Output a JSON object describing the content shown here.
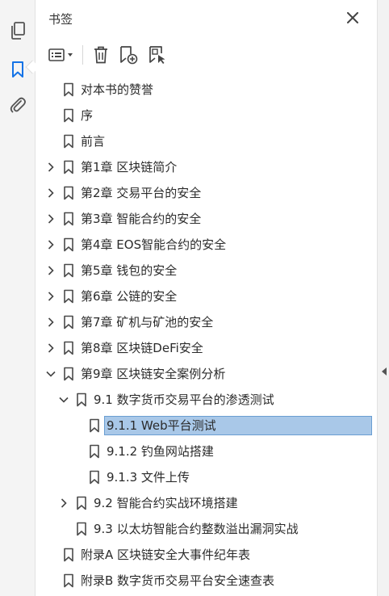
{
  "panel": {
    "title": "书签",
    "close_icon": "close-icon"
  },
  "rail": {
    "items": [
      {
        "name": "pages-icon"
      },
      {
        "name": "bookmark-icon",
        "active": true
      },
      {
        "name": "attachment-icon"
      }
    ]
  },
  "toolbar": {
    "buttons": [
      "options-menu-icon",
      "delete-bookmark-icon",
      "new-bookmark-icon",
      "new-bookmark-from-structure-icon"
    ]
  },
  "bookmarks": [
    {
      "label": "对本书的赞誉",
      "level": 0,
      "toggle": "none"
    },
    {
      "label": "序",
      "level": 0,
      "toggle": "none"
    },
    {
      "label": "前言",
      "level": 0,
      "toggle": "none"
    },
    {
      "label": "第1章 区块链简介",
      "level": 0,
      "toggle": "collapsed"
    },
    {
      "label": "第2章 交易平台的安全",
      "level": 0,
      "toggle": "collapsed"
    },
    {
      "label": "第3章 智能合约的安全",
      "level": 0,
      "toggle": "collapsed"
    },
    {
      "label": "第4章 EOS智能合约的安全",
      "level": 0,
      "toggle": "collapsed"
    },
    {
      "label": "第5章 钱包的安全",
      "level": 0,
      "toggle": "collapsed"
    },
    {
      "label": "第6章 公链的安全",
      "level": 0,
      "toggle": "collapsed"
    },
    {
      "label": "第7章 矿机与矿池的安全",
      "level": 0,
      "toggle": "collapsed"
    },
    {
      "label": "第8章 区块链DeFi安全",
      "level": 0,
      "toggle": "collapsed"
    },
    {
      "label": "第9章 区块链安全案例分析",
      "level": 0,
      "toggle": "expanded"
    },
    {
      "label": "9.1 数字货币交易平台的渗透测试",
      "level": 1,
      "toggle": "expanded"
    },
    {
      "label": "9.1.1 Web平台测试",
      "level": 2,
      "toggle": "none",
      "selected": true
    },
    {
      "label": "9.1.2 钓鱼网站搭建",
      "level": 2,
      "toggle": "none"
    },
    {
      "label": "9.1.3 文件上传",
      "level": 2,
      "toggle": "none"
    },
    {
      "label": "9.2 智能合约实战环境搭建",
      "level": 1,
      "toggle": "collapsed"
    },
    {
      "label": "9.3 以太坊智能合约整数溢出漏洞实战",
      "level": 1,
      "toggle": "none"
    },
    {
      "label": "附录A 区块链安全大事件纪年表",
      "level": 0,
      "toggle": "none"
    },
    {
      "label": "附录B 数字货币交易平台安全速查表",
      "level": 0,
      "toggle": "none"
    }
  ],
  "colors": {
    "selection": "#a9c8e8",
    "active_icon": "#1473e6"
  }
}
